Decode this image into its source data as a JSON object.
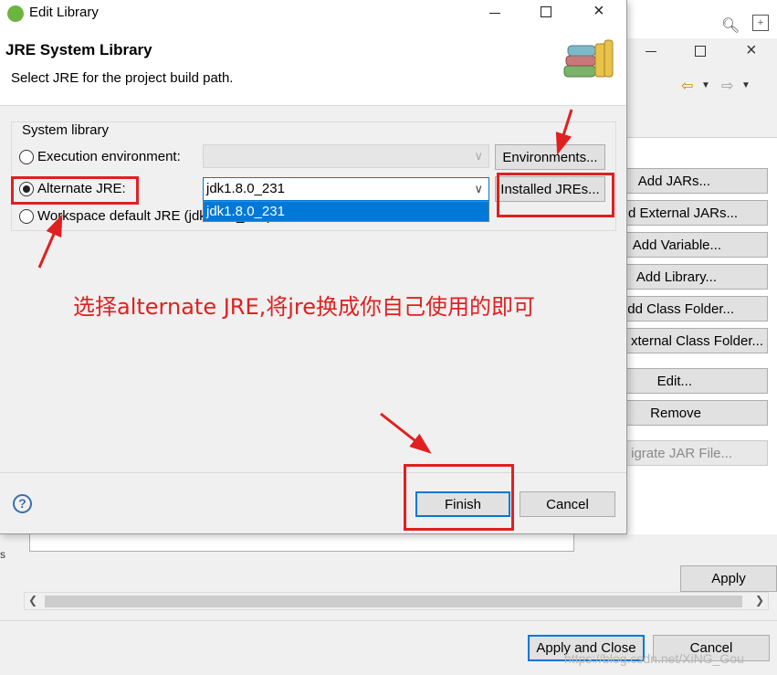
{
  "background_window": {
    "toolbar_icons": [
      "search-icon",
      "perspective-icon"
    ],
    "side_buttons": [
      {
        "label": "Add JARs...",
        "disabled": false
      },
      {
        "label": "d External JARs...",
        "disabled": false
      },
      {
        "label": "Add Variable...",
        "disabled": false
      },
      {
        "label": "Add Library...",
        "disabled": false
      },
      {
        "label": "dd Class Folder...",
        "disabled": false
      },
      {
        "label": "xternal Class Folder...",
        "disabled": false
      },
      {
        "label": "Edit...",
        "disabled": false
      },
      {
        "label": "Remove",
        "disabled": false
      },
      {
        "label": "igrate JAR File...",
        "disabled": true
      }
    ],
    "apply_label": "Apply",
    "apply_close_label": "Apply and Close",
    "cancel_label": "Cancel"
  },
  "dialog": {
    "title": "Edit Library",
    "header_title": "JRE System Library",
    "header_description": "Select JRE for the project build path.",
    "group_label": "System library",
    "execution_env_label": "Execution environment:",
    "environments_button": "Environments...",
    "alternate_jre_label": "Alternate JRE:",
    "alternate_jre_value": "jdk1.8.0_231",
    "dropdown_options": [
      "jdk1.8.0_231"
    ],
    "installed_jres_button": "Installed JREs...",
    "workspace_default_label": "Workspace default JRE (jdk1.8.0_231)",
    "finish_label": "Finish",
    "cancel_label": "Cancel",
    "help_icon": "help-icon"
  },
  "annotation_text": "选择alternate JRE,将jre换成你自己使用的即可",
  "watermark": "https://blog.csdn.net/XiNG_Gou",
  "colors": {
    "annotation_red": "#e02020",
    "selection_blue": "#0078d7",
    "focus_blue": "#0078d7"
  }
}
